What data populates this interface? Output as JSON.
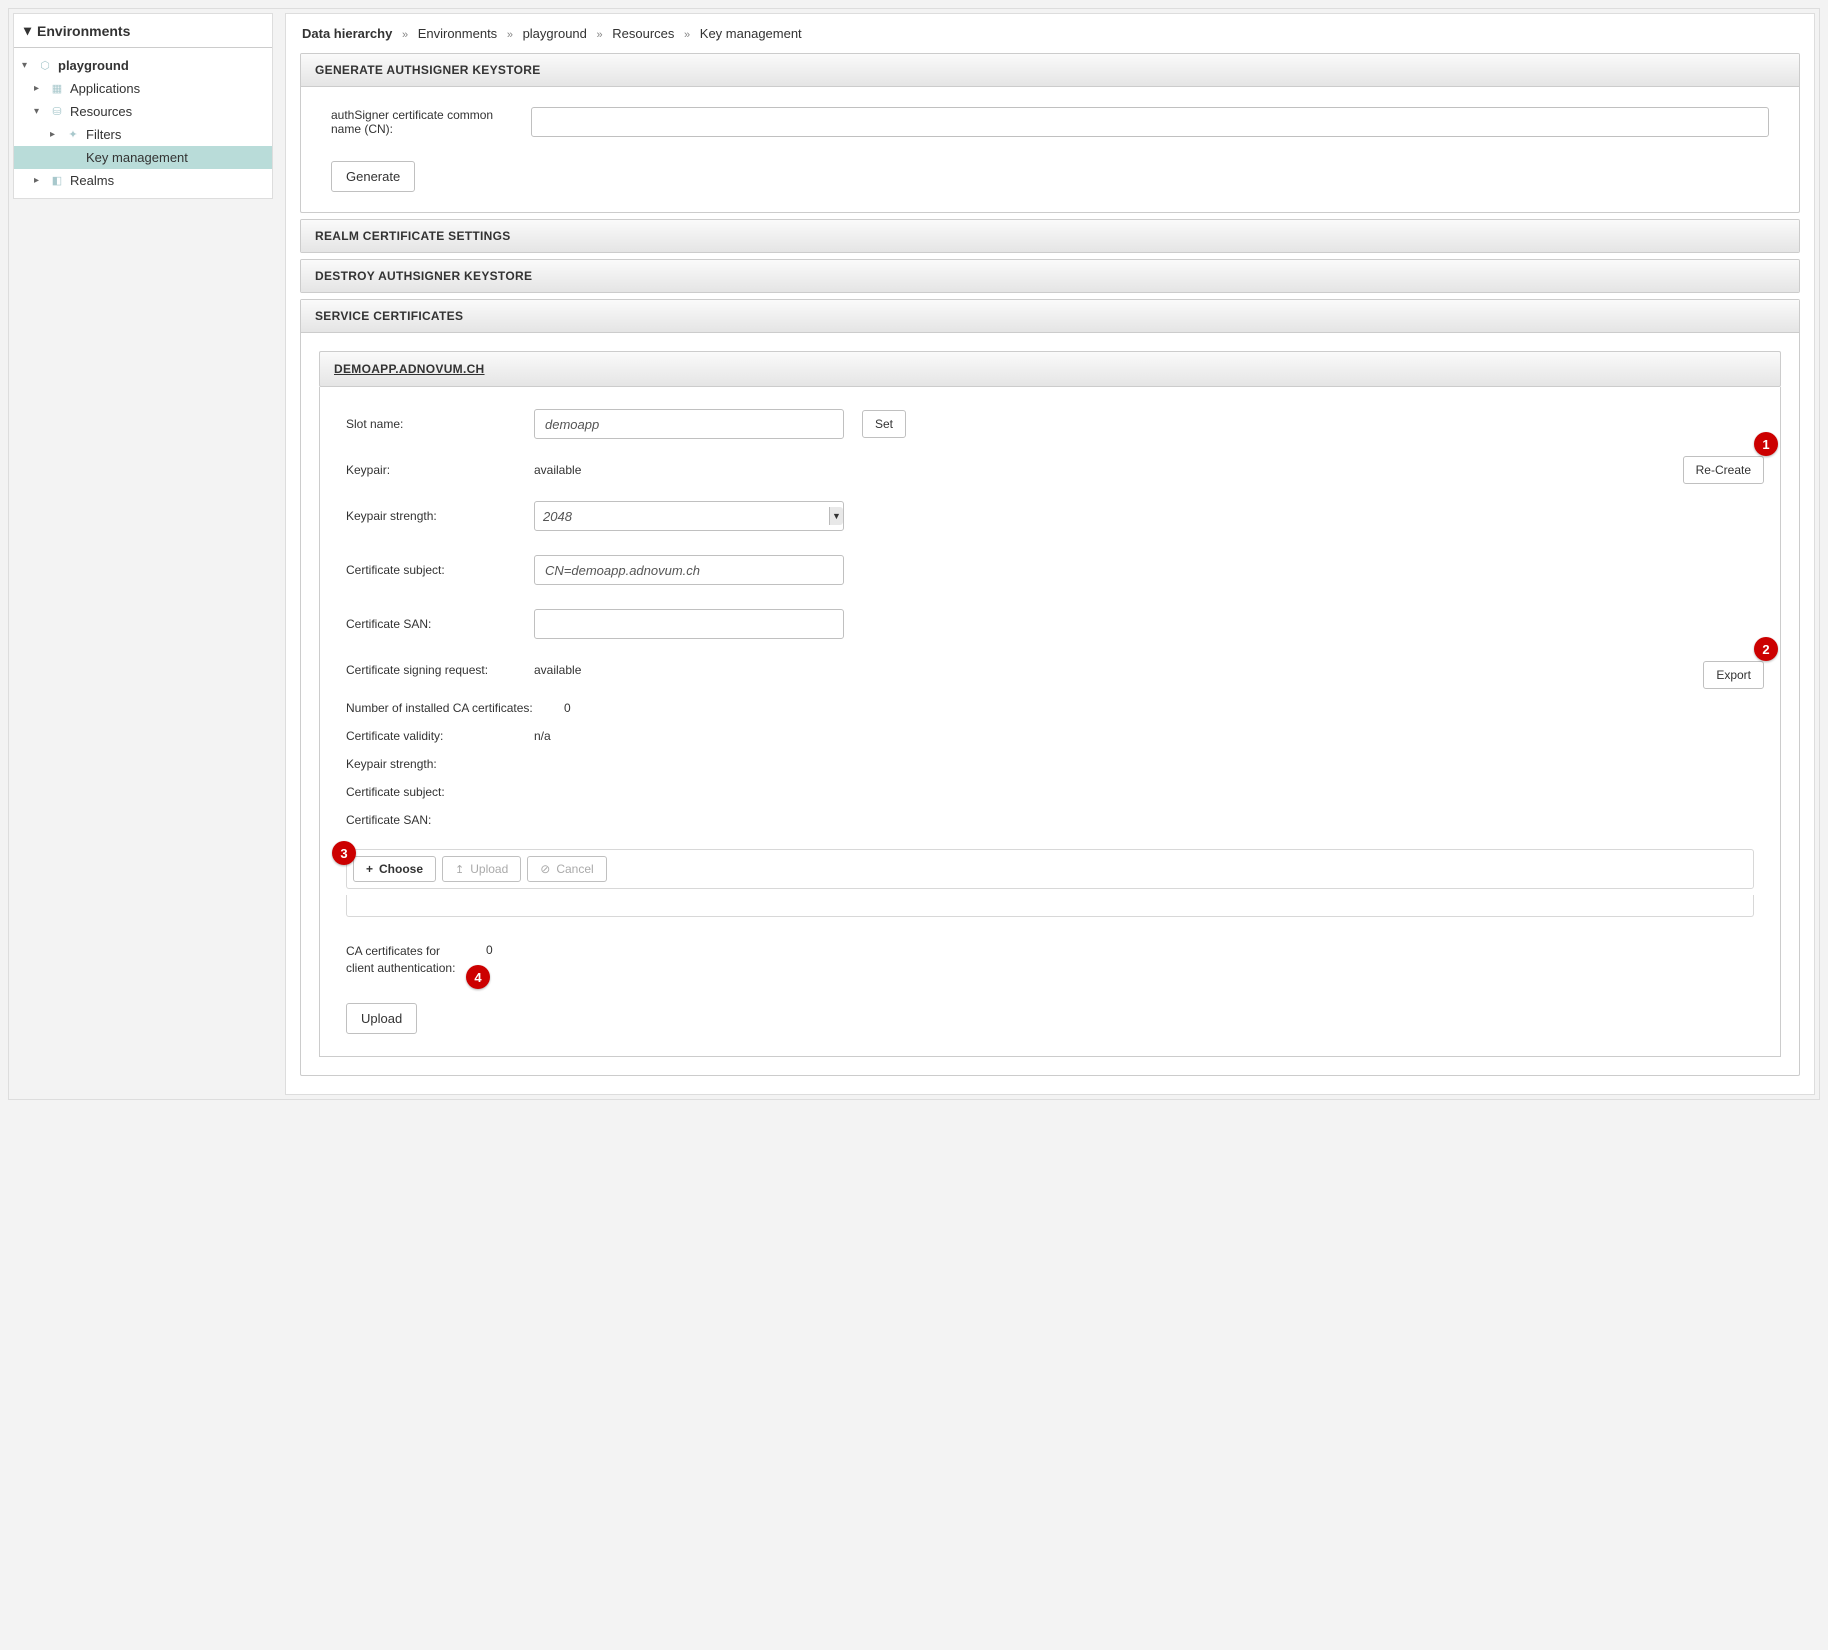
{
  "sidebar": {
    "title": "Environments",
    "nodes": {
      "playground": "playground",
      "applications": "Applications",
      "resources": "Resources",
      "filters": "Filters",
      "keymgmt": "Key management",
      "realms": "Realms"
    }
  },
  "breadcrumb": {
    "root": "Data hierarchy",
    "parts": [
      "Environments",
      "playground",
      "Resources",
      "Key management"
    ]
  },
  "panels": {
    "gen_authsigner": {
      "title": "GENERATE AUTHSIGNER KEYSTORE",
      "cn_label": "authSigner certificate common name (CN):",
      "cn_value": "",
      "generate_btn": "Generate"
    },
    "realm_cert": {
      "title": "REALM CERTIFICATE SETTINGS"
    },
    "destroy_authsigner": {
      "title": "DESTROY AUTHSIGNER KEYSTORE"
    },
    "service_certs": {
      "title": "SERVICE CERTIFICATES"
    }
  },
  "svc": {
    "host_title": "DEMOAPP.ADNOVUM.CH",
    "rows": {
      "slot_name_label": "Slot name:",
      "slot_name_value": "demoapp",
      "set_btn": "Set",
      "keypair_label": "Keypair:",
      "keypair_value": "available",
      "recreate_btn": "Re-Create",
      "keypair_strength_label": "Keypair strength:",
      "keypair_strength_value": "2048",
      "cert_subject_label": "Certificate subject:",
      "cert_subject_value": "CN=demoapp.adnovum.ch",
      "cert_san_label": "Certificate SAN:",
      "cert_san_value": "",
      "csr_label": "Certificate signing request:",
      "csr_value": "available",
      "export_btn": "Export",
      "num_ca_label": "Number of installed CA certificates:",
      "num_ca_value": "0",
      "cert_validity_label": "Certificate validity:",
      "cert_validity_value": "n/a",
      "keypair_strength2_label": "Keypair strength:",
      "keypair_strength2_value": "",
      "cert_subject2_label": "Certificate subject:",
      "cert_subject2_value": "",
      "cert_san2_label": "Certificate SAN:",
      "cert_san2_value": ""
    },
    "upload": {
      "choose": "Choose",
      "upload": "Upload",
      "cancel": "Cancel"
    },
    "ca_client": {
      "label": "CA certificates for client authentication:",
      "value": "0",
      "upload_btn": "Upload"
    }
  },
  "badges": {
    "b1": "1",
    "b2": "2",
    "b3": "3",
    "b4": "4"
  }
}
